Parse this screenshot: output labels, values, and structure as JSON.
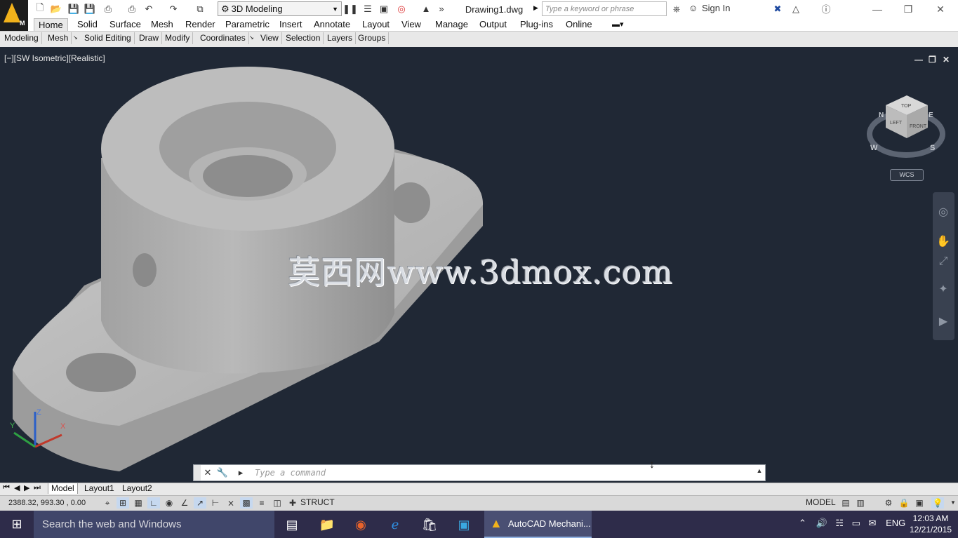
{
  "window": {
    "title": "Drawing1.dwg",
    "workspace": "3D Modeling",
    "search_placeholder": "Type a keyword or phrase",
    "sign_in": "Sign In",
    "logo_letter": "M"
  },
  "ribbon": {
    "tabs": [
      "Home",
      "Solid",
      "Surface",
      "Mesh",
      "Render",
      "Parametric",
      "Insert",
      "Annotate",
      "Layout",
      "View",
      "Manage",
      "Output",
      "Plug-ins",
      "Online"
    ],
    "active_tab": "Home",
    "panels": [
      "Modeling",
      "Mesh",
      "Solid Editing",
      "Draw",
      "Modify",
      "Coordinates",
      "View",
      "Selection",
      "Layers",
      "Groups"
    ]
  },
  "viewport": {
    "label": "[−][SW Isometric][Realistic]",
    "watermark": "莫西网www.3dmox.com",
    "viewcube": {
      "top": "TOP",
      "left": "LEFT",
      "front": "FRONT",
      "compass": [
        "N",
        "W",
        "S",
        "E"
      ]
    },
    "wcs": "WCS",
    "ucs": {
      "x": "X",
      "y": "Y",
      "z": "Z"
    }
  },
  "command_line": {
    "placeholder": "Type a command"
  },
  "layout_tabs": [
    "Model",
    "Layout1",
    "Layout2"
  ],
  "active_layout": "Model",
  "status": {
    "coords": "2388.32, 993.30 , 0.00",
    "struct": "STRUCT",
    "model": "MODEL"
  },
  "taskbar": {
    "search": "Search the web and Windows",
    "app": "AutoCAD Mechani...",
    "lang": "ENG",
    "time": "12:03 AM",
    "date": "12/21/2015"
  }
}
